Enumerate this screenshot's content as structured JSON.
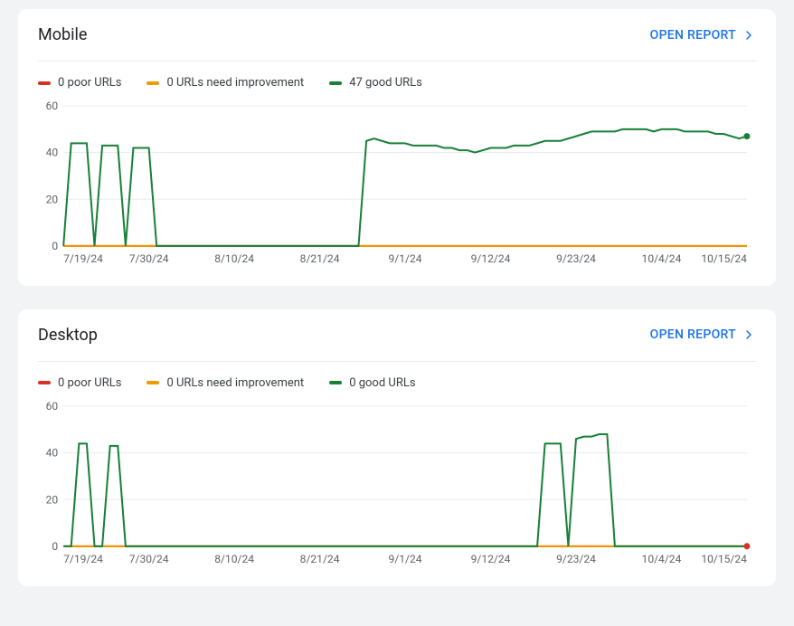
{
  "colors": {
    "poor": "#d93025",
    "improve": "#f29900",
    "good": "#188038",
    "action": "#1a73e8"
  },
  "open_report_label": "OPEN REPORT",
  "cards": [
    {
      "id": "mobile",
      "title": "Mobile",
      "legend": {
        "poor": "0 poor URLs",
        "improve": "0 URLs need improvement",
        "good": "47 good URLs"
      },
      "chart_id": "mobile-chart"
    },
    {
      "id": "desktop",
      "title": "Desktop",
      "legend": {
        "poor": "0 poor URLs",
        "improve": "0 URLs need improvement",
        "good": "0 good URLs"
      },
      "chart_id": "desktop-chart"
    }
  ],
  "chart_data": [
    {
      "id": "mobile-chart",
      "type": "line",
      "ylabel": "",
      "xlabel": "",
      "ylim": [
        0,
        60
      ],
      "yticks": [
        0,
        20,
        40,
        60
      ],
      "x": [
        "7/19/24",
        "7/20/24",
        "7/21/24",
        "7/22/24",
        "7/23/24",
        "7/24/24",
        "7/25/24",
        "7/26/24",
        "7/27/24",
        "7/28/24",
        "7/29/24",
        "7/30/24",
        "7/31/24",
        "8/1/24",
        "8/2/24",
        "8/3/24",
        "8/4/24",
        "8/5/24",
        "8/6/24",
        "8/7/24",
        "8/8/24",
        "8/9/24",
        "8/10/24",
        "8/11/24",
        "8/12/24",
        "8/13/24",
        "8/14/24",
        "8/15/24",
        "8/16/24",
        "8/17/24",
        "8/18/24",
        "8/19/24",
        "8/20/24",
        "8/21/24",
        "8/22/24",
        "8/23/24",
        "8/24/24",
        "8/25/24",
        "8/26/24",
        "8/27/24",
        "8/28/24",
        "8/29/24",
        "8/30/24",
        "8/31/24",
        "9/1/24",
        "9/2/24",
        "9/3/24",
        "9/4/24",
        "9/5/24",
        "9/6/24",
        "9/7/24",
        "9/8/24",
        "9/9/24",
        "9/10/24",
        "9/11/24",
        "9/12/24",
        "9/13/24",
        "9/14/24",
        "9/15/24",
        "9/16/24",
        "9/17/24",
        "9/18/24",
        "9/19/24",
        "9/20/24",
        "9/21/24",
        "9/22/24",
        "9/23/24",
        "9/24/24",
        "9/25/24",
        "9/26/24",
        "9/27/24",
        "9/28/24",
        "9/29/24",
        "9/30/24",
        "10/1/24",
        "10/2/24",
        "10/3/24",
        "10/4/24",
        "10/5/24",
        "10/6/24",
        "10/7/24",
        "10/8/24",
        "10/9/24",
        "10/10/24",
        "10/11/24",
        "10/12/24",
        "10/13/24",
        "10/14/24",
        "10/15/24"
      ],
      "xticks": [
        "7/19/24",
        "7/30/24",
        "8/10/24",
        "8/21/24",
        "9/1/24",
        "9/12/24",
        "9/23/24",
        "10/4/24",
        "10/15/24"
      ],
      "series": [
        {
          "name": "poor",
          "values": [
            0,
            0,
            0,
            0,
            0,
            0,
            0,
            0,
            0,
            0,
            0,
            0,
            0,
            0,
            0,
            0,
            0,
            0,
            0,
            0,
            0,
            0,
            0,
            0,
            0,
            0,
            0,
            0,
            0,
            0,
            0,
            0,
            0,
            0,
            0,
            0,
            0,
            0,
            0,
            0,
            0,
            0,
            0,
            0,
            0,
            0,
            0,
            0,
            0,
            0,
            0,
            0,
            0,
            0,
            0,
            0,
            0,
            0,
            0,
            0,
            0,
            0,
            0,
            0,
            0,
            0,
            0,
            0,
            0,
            0,
            0,
            0,
            0,
            0,
            0,
            0,
            0,
            0,
            0,
            0,
            0,
            0,
            0,
            0,
            0,
            0,
            0,
            0,
            0
          ]
        },
        {
          "name": "improve",
          "values": [
            0,
            0,
            0,
            0,
            0,
            0,
            0,
            0,
            0,
            0,
            0,
            0,
            0,
            0,
            0,
            0,
            0,
            0,
            0,
            0,
            0,
            0,
            0,
            0,
            0,
            0,
            0,
            0,
            0,
            0,
            0,
            0,
            0,
            0,
            0,
            0,
            0,
            0,
            0,
            0,
            0,
            0,
            0,
            0,
            0,
            0,
            0,
            0,
            0,
            0,
            0,
            0,
            0,
            0,
            0,
            0,
            0,
            0,
            0,
            0,
            0,
            0,
            0,
            0,
            0,
            0,
            0,
            0,
            0,
            0,
            0,
            0,
            0,
            0,
            0,
            0,
            0,
            0,
            0,
            0,
            0,
            0,
            0,
            0,
            0,
            0,
            0,
            0,
            0
          ]
        },
        {
          "name": "good",
          "values": [
            0,
            44,
            44,
            44,
            0,
            43,
            43,
            43,
            0,
            42,
            42,
            42,
            0,
            0,
            0,
            0,
            0,
            0,
            0,
            0,
            0,
            0,
            0,
            0,
            0,
            0,
            0,
            0,
            0,
            0,
            0,
            0,
            0,
            0,
            0,
            0,
            0,
            0,
            0,
            45,
            46,
            45,
            44,
            44,
            44,
            43,
            43,
            43,
            43,
            42,
            42,
            41,
            41,
            40,
            41,
            42,
            42,
            42,
            43,
            43,
            43,
            44,
            45,
            45,
            45,
            46,
            47,
            48,
            49,
            49,
            49,
            49,
            50,
            50,
            50,
            50,
            49,
            50,
            50,
            50,
            49,
            49,
            49,
            49,
            48,
            48,
            47,
            46,
            47
          ]
        }
      ],
      "end_marker_series": "good"
    },
    {
      "id": "desktop-chart",
      "type": "line",
      "ylabel": "",
      "xlabel": "",
      "ylim": [
        0,
        60
      ],
      "yticks": [
        0,
        20,
        40,
        60
      ],
      "x": [
        "7/19/24",
        "7/20/24",
        "7/21/24",
        "7/22/24",
        "7/23/24",
        "7/24/24",
        "7/25/24",
        "7/26/24",
        "7/27/24",
        "7/28/24",
        "7/29/24",
        "7/30/24",
        "7/31/24",
        "8/1/24",
        "8/2/24",
        "8/3/24",
        "8/4/24",
        "8/5/24",
        "8/6/24",
        "8/7/24",
        "8/8/24",
        "8/9/24",
        "8/10/24",
        "8/11/24",
        "8/12/24",
        "8/13/24",
        "8/14/24",
        "8/15/24",
        "8/16/24",
        "8/17/24",
        "8/18/24",
        "8/19/24",
        "8/20/24",
        "8/21/24",
        "8/22/24",
        "8/23/24",
        "8/24/24",
        "8/25/24",
        "8/26/24",
        "8/27/24",
        "8/28/24",
        "8/29/24",
        "8/30/24",
        "8/31/24",
        "9/1/24",
        "9/2/24",
        "9/3/24",
        "9/4/24",
        "9/5/24",
        "9/6/24",
        "9/7/24",
        "9/8/24",
        "9/9/24",
        "9/10/24",
        "9/11/24",
        "9/12/24",
        "9/13/24",
        "9/14/24",
        "9/15/24",
        "9/16/24",
        "9/17/24",
        "9/18/24",
        "9/19/24",
        "9/20/24",
        "9/21/24",
        "9/22/24",
        "9/23/24",
        "9/24/24",
        "9/25/24",
        "9/26/24",
        "9/27/24",
        "9/28/24",
        "9/29/24",
        "9/30/24",
        "10/1/24",
        "10/2/24",
        "10/3/24",
        "10/4/24",
        "10/5/24",
        "10/6/24",
        "10/7/24",
        "10/8/24",
        "10/9/24",
        "10/10/24",
        "10/11/24",
        "10/12/24",
        "10/13/24",
        "10/14/24",
        "10/15/24"
      ],
      "xticks": [
        "7/19/24",
        "7/30/24",
        "8/10/24",
        "8/21/24",
        "9/1/24",
        "9/12/24",
        "9/23/24",
        "10/4/24",
        "10/15/24"
      ],
      "series": [
        {
          "name": "poor",
          "values": [
            0,
            0,
            0,
            0,
            0,
            0,
            0,
            0,
            0,
            0,
            0,
            0,
            0,
            0,
            0,
            0,
            0,
            0,
            0,
            0,
            0,
            0,
            0,
            0,
            0,
            0,
            0,
            0,
            0,
            0,
            0,
            0,
            0,
            0,
            0,
            0,
            0,
            0,
            0,
            0,
            0,
            0,
            0,
            0,
            0,
            0,
            0,
            0,
            0,
            0,
            0,
            0,
            0,
            0,
            0,
            0,
            0,
            0,
            0,
            0,
            0,
            0,
            0,
            0,
            0,
            0,
            0,
            0,
            0,
            0,
            0,
            0,
            0,
            0,
            0,
            0,
            0,
            0,
            0,
            0,
            0,
            0,
            0,
            0,
            0,
            0,
            0,
            0,
            0
          ]
        },
        {
          "name": "improve",
          "values": [
            0,
            0,
            0,
            0,
            0,
            0,
            0,
            0,
            0,
            0,
            0,
            0,
            0,
            0,
            0,
            0,
            0,
            0,
            0,
            0,
            0,
            0,
            0,
            0,
            0,
            0,
            0,
            0,
            0,
            0,
            0,
            0,
            0,
            0,
            0,
            0,
            0,
            0,
            0,
            0,
            0,
            0,
            0,
            0,
            0,
            0,
            0,
            0,
            0,
            0,
            0,
            0,
            0,
            0,
            0,
            0,
            0,
            0,
            0,
            0,
            0,
            0,
            0,
            0,
            0,
            0,
            0,
            0,
            0,
            0,
            0,
            0,
            0,
            0,
            0,
            0,
            0,
            0,
            0,
            0,
            0,
            0,
            0,
            0,
            0,
            0,
            0,
            0,
            0
          ]
        },
        {
          "name": "good",
          "values": [
            0,
            0,
            44,
            44,
            0,
            0,
            43,
            43,
            0,
            0,
            0,
            0,
            0,
            0,
            0,
            0,
            0,
            0,
            0,
            0,
            0,
            0,
            0,
            0,
            0,
            0,
            0,
            0,
            0,
            0,
            0,
            0,
            0,
            0,
            0,
            0,
            0,
            0,
            0,
            0,
            0,
            0,
            0,
            0,
            0,
            0,
            0,
            0,
            0,
            0,
            0,
            0,
            0,
            0,
            0,
            0,
            0,
            0,
            0,
            0,
            0,
            0,
            44,
            44,
            44,
            0,
            46,
            47,
            47,
            48,
            48,
            0,
            0,
            0,
            0,
            0,
            0,
            0,
            0,
            0,
            0,
            0,
            0,
            0,
            0,
            0,
            0,
            0,
            0
          ]
        }
      ],
      "end_marker_series": "poor"
    }
  ]
}
